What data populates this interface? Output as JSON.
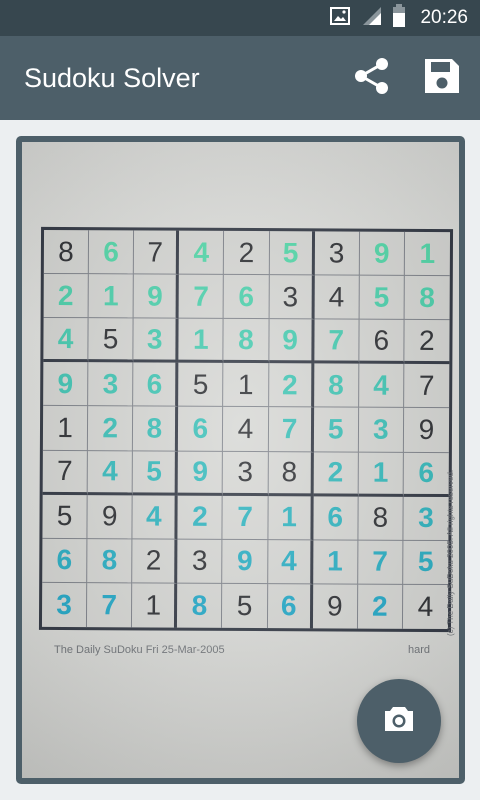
{
  "status_bar": {
    "time": "20:26",
    "icons": [
      "image-icon",
      "signal-icon",
      "battery-icon"
    ]
  },
  "app_bar": {
    "title": "Sudoku Solver",
    "actions": [
      "share-icon",
      "save-icon"
    ]
  },
  "preview": {
    "caption_left": "The Daily SuDoku  Fri 25-Mar-2005",
    "caption_right": "hard",
    "side_text": "(c) The Daily SuDoku 2005. All rights reserved.",
    "grid": [
      [
        {
          "v": "8",
          "t": "g"
        },
        {
          "v": "6",
          "t": "s"
        },
        {
          "v": "7",
          "t": "g"
        },
        {
          "v": "4",
          "t": "s"
        },
        {
          "v": "2",
          "t": "g"
        },
        {
          "v": "5",
          "t": "s"
        },
        {
          "v": "3",
          "t": "g"
        },
        {
          "v": "9",
          "t": "s"
        },
        {
          "v": "1",
          "t": "s"
        }
      ],
      [
        {
          "v": "2",
          "t": "s"
        },
        {
          "v": "1",
          "t": "s"
        },
        {
          "v": "9",
          "t": "s"
        },
        {
          "v": "7",
          "t": "s"
        },
        {
          "v": "6",
          "t": "s"
        },
        {
          "v": "3",
          "t": "g"
        },
        {
          "v": "4",
          "t": "g"
        },
        {
          "v": "5",
          "t": "s"
        },
        {
          "v": "8",
          "t": "s"
        }
      ],
      [
        {
          "v": "4",
          "t": "s"
        },
        {
          "v": "5",
          "t": "g"
        },
        {
          "v": "3",
          "t": "s"
        },
        {
          "v": "1",
          "t": "s"
        },
        {
          "v": "8",
          "t": "s"
        },
        {
          "v": "9",
          "t": "s"
        },
        {
          "v": "7",
          "t": "s"
        },
        {
          "v": "6",
          "t": "g"
        },
        {
          "v": "2",
          "t": "g"
        }
      ],
      [
        {
          "v": "9",
          "t": "s"
        },
        {
          "v": "3",
          "t": "s"
        },
        {
          "v": "6",
          "t": "s"
        },
        {
          "v": "5",
          "t": "g"
        },
        {
          "v": "1",
          "t": "g"
        },
        {
          "v": "2",
          "t": "s"
        },
        {
          "v": "8",
          "t": "s"
        },
        {
          "v": "4",
          "t": "s"
        },
        {
          "v": "7",
          "t": "g"
        }
      ],
      [
        {
          "v": "1",
          "t": "g"
        },
        {
          "v": "2",
          "t": "s"
        },
        {
          "v": "8",
          "t": "s"
        },
        {
          "v": "6",
          "t": "s"
        },
        {
          "v": "4",
          "t": "g"
        },
        {
          "v": "7",
          "t": "s"
        },
        {
          "v": "5",
          "t": "s"
        },
        {
          "v": "3",
          "t": "s"
        },
        {
          "v": "9",
          "t": "g"
        }
      ],
      [
        {
          "v": "7",
          "t": "g"
        },
        {
          "v": "4",
          "t": "s"
        },
        {
          "v": "5",
          "t": "s"
        },
        {
          "v": "9",
          "t": "s"
        },
        {
          "v": "3",
          "t": "g"
        },
        {
          "v": "8",
          "t": "g"
        },
        {
          "v": "2",
          "t": "s"
        },
        {
          "v": "1",
          "t": "s"
        },
        {
          "v": "6",
          "t": "s"
        }
      ],
      [
        {
          "v": "5",
          "t": "g"
        },
        {
          "v": "9",
          "t": "g"
        },
        {
          "v": "4",
          "t": "s"
        },
        {
          "v": "2",
          "t": "s"
        },
        {
          "v": "7",
          "t": "s"
        },
        {
          "v": "1",
          "t": "s"
        },
        {
          "v": "6",
          "t": "s"
        },
        {
          "v": "8",
          "t": "g"
        },
        {
          "v": "3",
          "t": "s"
        }
      ],
      [
        {
          "v": "6",
          "t": "s"
        },
        {
          "v": "8",
          "t": "s"
        },
        {
          "v": "2",
          "t": "g"
        },
        {
          "v": "3",
          "t": "g"
        },
        {
          "v": "9",
          "t": "s"
        },
        {
          "v": "4",
          "t": "s"
        },
        {
          "v": "1",
          "t": "s"
        },
        {
          "v": "7",
          "t": "s"
        },
        {
          "v": "5",
          "t": "s"
        }
      ],
      [
        {
          "v": "3",
          "t": "s"
        },
        {
          "v": "7",
          "t": "s"
        },
        {
          "v": "1",
          "t": "g"
        },
        {
          "v": "8",
          "t": "s"
        },
        {
          "v": "5",
          "t": "g"
        },
        {
          "v": "6",
          "t": "s"
        },
        {
          "v": "9",
          "t": "g"
        },
        {
          "v": "2",
          "t": "s"
        },
        {
          "v": "4",
          "t": "g"
        }
      ]
    ]
  },
  "fab": {
    "icon": "camera-icon"
  },
  "colors": {
    "status_bar": "#37474f",
    "app_bar": "#4d5f69",
    "given_digit": "#2a2c30",
    "solved_digit_top": "#4fd8a8",
    "solved_digit_bottom": "#1fa8c8"
  }
}
